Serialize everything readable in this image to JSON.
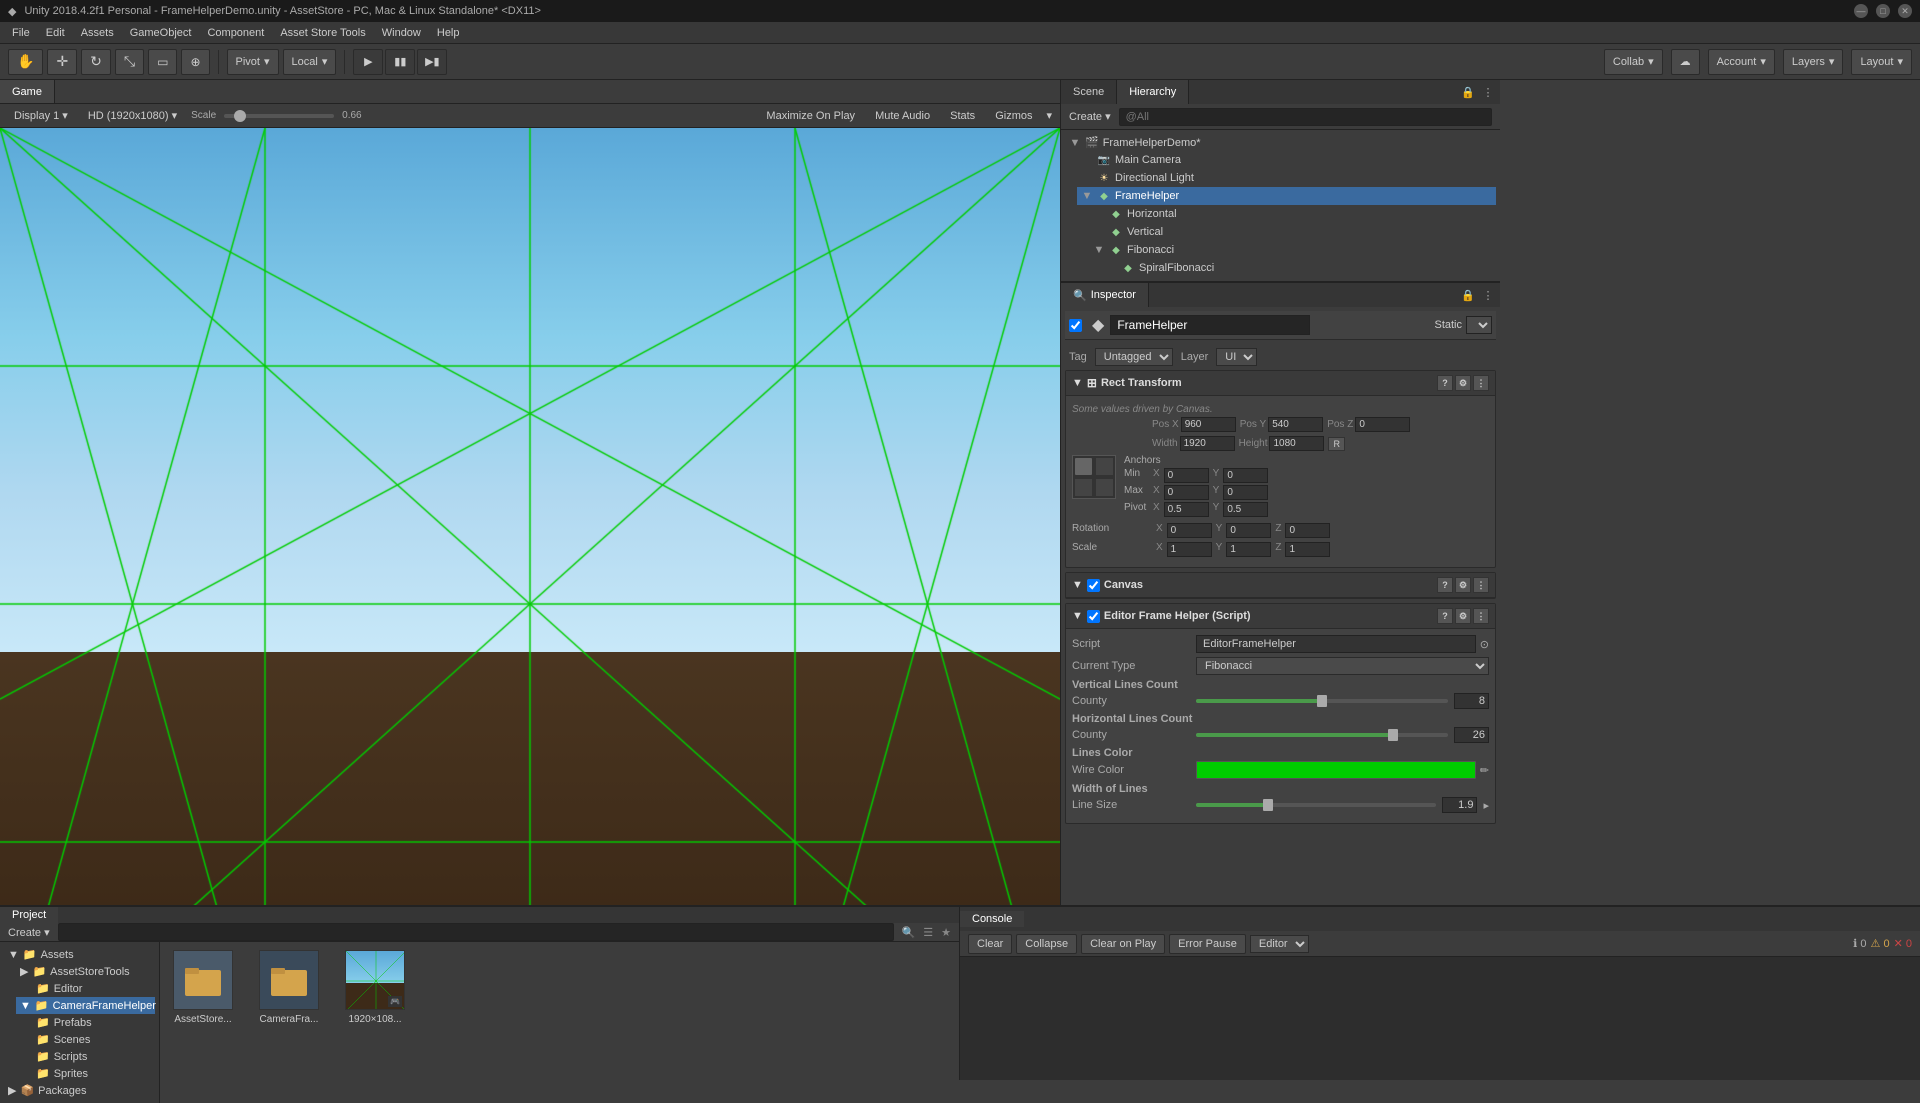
{
  "titlebar": {
    "title": "Unity 2018.4.2f1 Personal - FrameHelperDemo.unity - AssetStore - PC, Mac & Linux Standalone* <DX11>",
    "controls": [
      "minimize",
      "maximize",
      "close"
    ]
  },
  "menubar": {
    "items": [
      "File",
      "Edit",
      "Assets",
      "GameObject",
      "Component",
      "Asset Store Tools",
      "Window",
      "Help"
    ]
  },
  "toolbar": {
    "pivot_label": "Pivot",
    "local_label": "Local",
    "collab_label": "Collab",
    "account_label": "Account",
    "layers_label": "Layers",
    "layout_label": "Layout"
  },
  "game_view": {
    "tab_label": "Game",
    "display": "Display 1",
    "resolution": "HD (1920x1080)",
    "scale_label": "Scale",
    "scale_value": "0.66",
    "toolbar_items": [
      "Maximize On Play",
      "Mute Audio",
      "Stats",
      "Gizmos"
    ]
  },
  "hierarchy": {
    "panel_label": "Hierarchy",
    "scene_label": "Scene",
    "search_placeholder": "@All",
    "create_label": "Create",
    "items": [
      {
        "name": "FrameHelperDemo*",
        "level": 0,
        "hasArrow": true,
        "type": "scene"
      },
      {
        "name": "Main Camera",
        "level": 1,
        "hasArrow": false,
        "type": "camera"
      },
      {
        "name": "Directional Light",
        "level": 1,
        "hasArrow": false,
        "type": "light"
      },
      {
        "name": "FrameHelper",
        "level": 1,
        "hasArrow": true,
        "type": "go",
        "selected": true
      },
      {
        "name": "Horizontal",
        "level": 2,
        "hasArrow": false,
        "type": "go"
      },
      {
        "name": "Vertical",
        "level": 2,
        "hasArrow": false,
        "type": "go"
      },
      {
        "name": "Fibonacci",
        "level": 2,
        "hasArrow": true,
        "type": "go"
      },
      {
        "name": "SpiralFibonacci",
        "level": 3,
        "hasArrow": false,
        "type": "go"
      }
    ]
  },
  "inspector": {
    "panel_label": "Inspector",
    "object_name": "FrameHelper",
    "static_label": "Static",
    "tag": "Untagged",
    "layer": "UI",
    "rect_transform": {
      "label": "Rect Transform",
      "hint": "Some values driven by Canvas.",
      "pos_x": "960",
      "pos_y": "540",
      "pos_z": "0",
      "width": "1920",
      "height": "1080",
      "anchors_min_x": "0",
      "anchors_min_y": "0",
      "anchors_max_x": "0",
      "anchors_max_y": "0",
      "pivot_x": "0.5",
      "pivot_y": "0.5",
      "rotation_x": "0",
      "rotation_y": "0",
      "rotation_z": "0",
      "scale_x": "1",
      "scale_y": "1",
      "scale_z": "1",
      "btn_label": "R"
    },
    "canvas": {
      "label": "Canvas"
    },
    "editor_frame_helper": {
      "label": "Editor Frame Helper (Script)",
      "script_label": "Script",
      "script_value": "EditorFrameHelper",
      "current_type_label": "Current Type",
      "current_type_value": "Fibonacci",
      "vertical_lines_label": "Vertical Lines Count",
      "vertical_county_label": "County",
      "vertical_value": "8",
      "vertical_slider_pct": 50,
      "horizontal_lines_label": "Horizontal Lines Count",
      "horizontal_county_label": "County",
      "horizontal_value": "26",
      "horizontal_slider_pct": 78,
      "lines_color_label": "Lines Color",
      "wire_color_label": "Wire Color",
      "color_hex": "#00cc00",
      "width_of_lines_label": "Width of Lines",
      "line_size_label": "Line Size",
      "line_size_value": "1.9",
      "line_size_slider_pct": 30
    }
  },
  "project": {
    "tab_label": "Project",
    "create_label": "Create",
    "search_placeholder": "",
    "folders": [
      {
        "name": "Assets",
        "level": 0,
        "hasArrow": true
      },
      {
        "name": "AssetStoreTools",
        "level": 1,
        "hasArrow": false
      },
      {
        "name": "Editor",
        "level": 2,
        "hasArrow": false
      },
      {
        "name": "CameraFrameHelper",
        "level": 1,
        "hasArrow": true
      },
      {
        "name": "Prefabs",
        "level": 2,
        "hasArrow": false
      },
      {
        "name": "Scenes",
        "level": 2,
        "hasArrow": false
      },
      {
        "name": "Scripts",
        "level": 2,
        "hasArrow": false
      },
      {
        "name": "Sprites",
        "level": 2,
        "hasArrow": false
      },
      {
        "name": "Packages",
        "level": 0,
        "hasArrow": true
      }
    ],
    "assets": [
      {
        "name": "AssetStore...",
        "type": "folder"
      },
      {
        "name": "CameraFra...",
        "type": "folder"
      },
      {
        "name": "1920×108...",
        "type": "image"
      }
    ]
  },
  "console": {
    "tab_label": "Console",
    "clear_label": "Clear",
    "collapse_label": "Collapse",
    "clear_on_play_label": "Clear on Play",
    "error_pause_label": "Error Pause",
    "editor_label": "Editor",
    "counts": {
      "info": "0",
      "warning": "0",
      "error": "0"
    }
  }
}
